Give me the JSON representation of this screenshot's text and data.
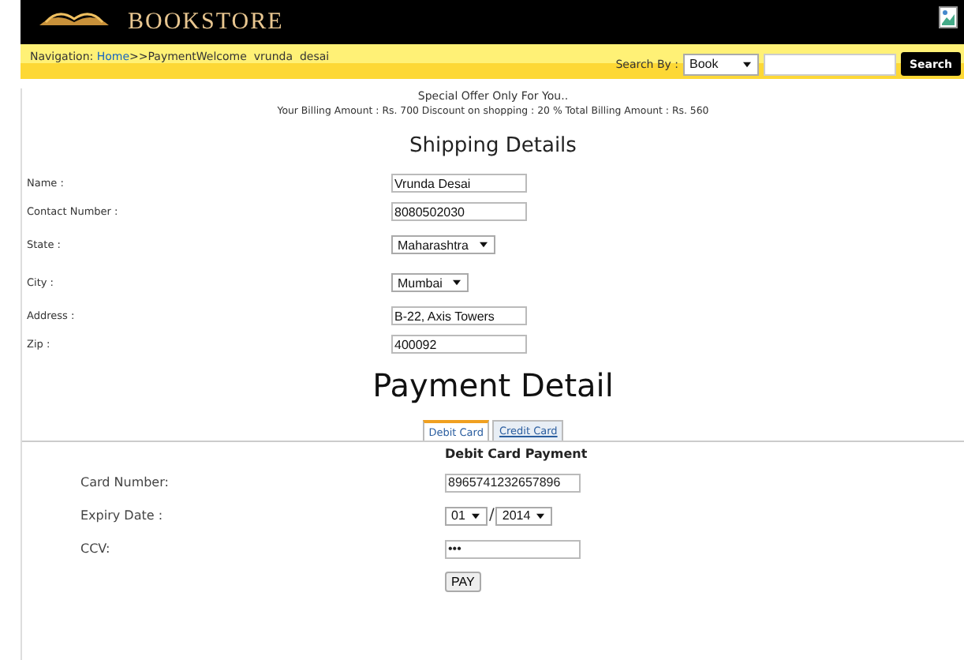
{
  "header": {
    "logo_text": "BOOKSTORE"
  },
  "nav": {
    "prefix": "Navigation: ",
    "home_link": "Home",
    "trail": ">>PaymentWelcome  vrunda  desai",
    "search_label": "Search By :",
    "search_by": "Book",
    "search_button": "Search"
  },
  "offer": {
    "title": "Special Offer Only For You..",
    "details": "Your Billing Amount : Rs. 700 Discount on shopping : 20 % Total Billing Amount : Rs. 560"
  },
  "shipping": {
    "title": "Shipping Details",
    "fields": [
      {
        "label": "Name :",
        "kind": "text",
        "value": "Vrunda Desai"
      },
      {
        "label": "Contact Number :",
        "kind": "text",
        "value": "8080502030"
      },
      {
        "label": "State :",
        "kind": "select",
        "value": "Maharashtra"
      },
      {
        "label": "City :",
        "kind": "select",
        "value": "Mumbai"
      },
      {
        "label": "Address :",
        "kind": "text",
        "value": "B-22, Axis Towers"
      },
      {
        "label": "Zip :",
        "kind": "text",
        "value": "400092"
      }
    ]
  },
  "payment": {
    "title": "Payment Detail",
    "tabs": [
      {
        "label": "Debit Card",
        "selected": true
      },
      {
        "label": "Credit Card",
        "selected": false
      }
    ],
    "panel_title": "Debit Card Payment",
    "card_number": {
      "label": "Card Number:",
      "value": "8965741232657896"
    },
    "expiry": {
      "label": "Expiry Date :",
      "month": "01",
      "separator": "/",
      "year": "2014"
    },
    "ccv": {
      "label": "CCV:",
      "value": "•••"
    },
    "pay_button": "PAY"
  }
}
